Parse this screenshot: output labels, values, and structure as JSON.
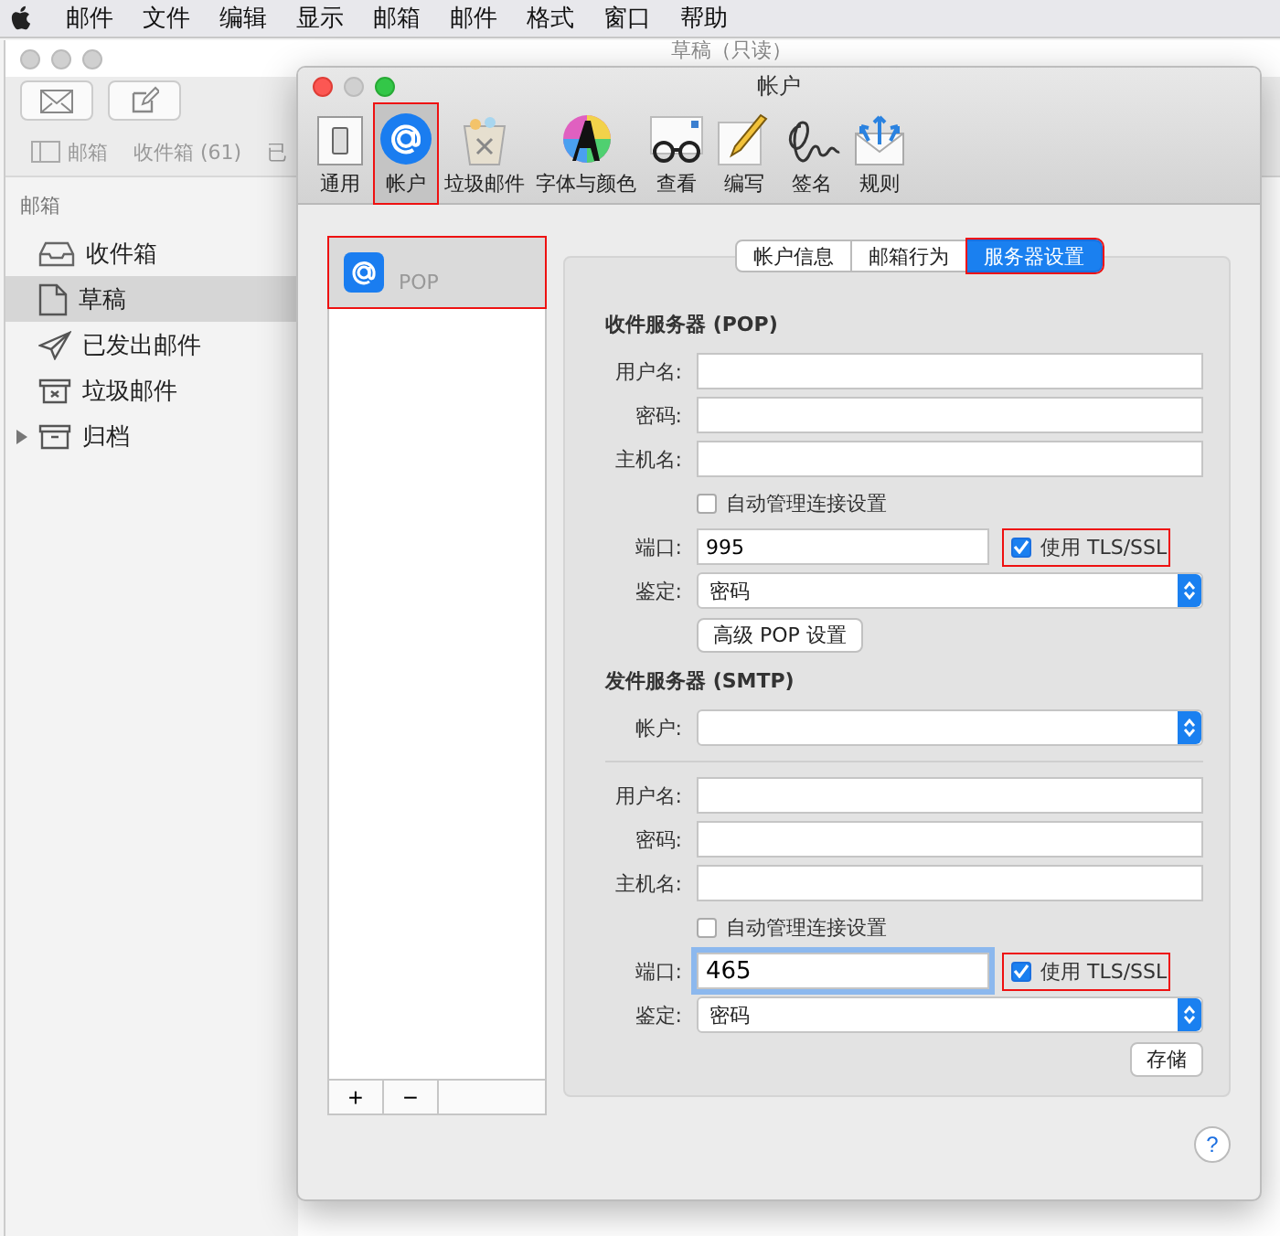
{
  "menu_bar": [
    "邮件",
    "文件",
    "编辑",
    "显示",
    "邮箱",
    "邮件",
    "格式",
    "窗口",
    "帮助"
  ],
  "main_window": {
    "title": "草稿（只读）",
    "toolbar": [
      "邮箱",
      "收件箱 (61)",
      "已"
    ],
    "sidebar": {
      "header": "邮箱",
      "items": [
        {
          "label": "收件箱",
          "selected": false,
          "expandable": false
        },
        {
          "label": "草稿",
          "selected": true,
          "expandable": false
        },
        {
          "label": "已发出邮件",
          "selected": false,
          "expandable": false
        },
        {
          "label": "垃圾邮件",
          "selected": false,
          "expandable": false
        },
        {
          "label": "归档",
          "selected": false,
          "expandable": true
        }
      ]
    }
  },
  "dialog": {
    "title": "帐户",
    "toolbar": [
      {
        "label": "通用",
        "selected": false
      },
      {
        "label": "帐户",
        "selected": true
      },
      {
        "label": "垃圾邮件",
        "selected": false
      },
      {
        "label": "字体与颜色",
        "selected": false
      },
      {
        "label": "查看",
        "selected": false
      },
      {
        "label": "编写",
        "selected": false
      },
      {
        "label": "签名",
        "selected": false
      },
      {
        "label": "规则",
        "selected": false
      }
    ],
    "accounts": [
      {
        "label": "POP",
        "selected": true
      }
    ],
    "account_buttons": [
      "+",
      "−"
    ],
    "tabs": [
      {
        "label": "帐户信息",
        "selected": false
      },
      {
        "label": "邮箱行为",
        "selected": false
      },
      {
        "label": "服务器设置",
        "selected": true
      }
    ],
    "sections": [
      {
        "heading": "收件服务器 (POP)",
        "rows": [
          {
            "kind": "text",
            "label": "用户名:"
          },
          {
            "kind": "text",
            "label": "密码:"
          },
          {
            "kind": "text",
            "label": "主机名:"
          },
          {
            "kind": "checkbox",
            "label": "自动管理连接设置",
            "checked": false
          },
          {
            "kind": "port",
            "label": "端口:",
            "value": "995",
            "focused": false,
            "tls": {
              "label": "使用 TLS/SSL",
              "checked": true,
              "annotated": true
            }
          },
          {
            "kind": "select",
            "label": "鉴定:",
            "value": "密码"
          },
          {
            "kind": "button",
            "label": "高级 POP 设置"
          }
        ]
      },
      {
        "heading": "发件服务器 (SMTP)",
        "rows": [
          {
            "kind": "select",
            "label": "帐户:"
          },
          {
            "kind": "divider"
          },
          {
            "kind": "text",
            "label": "用户名:"
          },
          {
            "kind": "text",
            "label": "密码:"
          },
          {
            "kind": "text",
            "label": "主机名:"
          },
          {
            "kind": "checkbox",
            "label": "自动管理连接设置",
            "checked": false
          },
          {
            "kind": "port",
            "label": "端口:",
            "value": "465",
            "focused": true,
            "tls": {
              "label": "使用 TLS/SSL",
              "checked": true,
              "annotated": true
            }
          },
          {
            "kind": "select",
            "label": "鉴定:",
            "value": "密码"
          },
          {
            "kind": "save",
            "label": "存储"
          }
        ]
      }
    ],
    "help": "?"
  }
}
